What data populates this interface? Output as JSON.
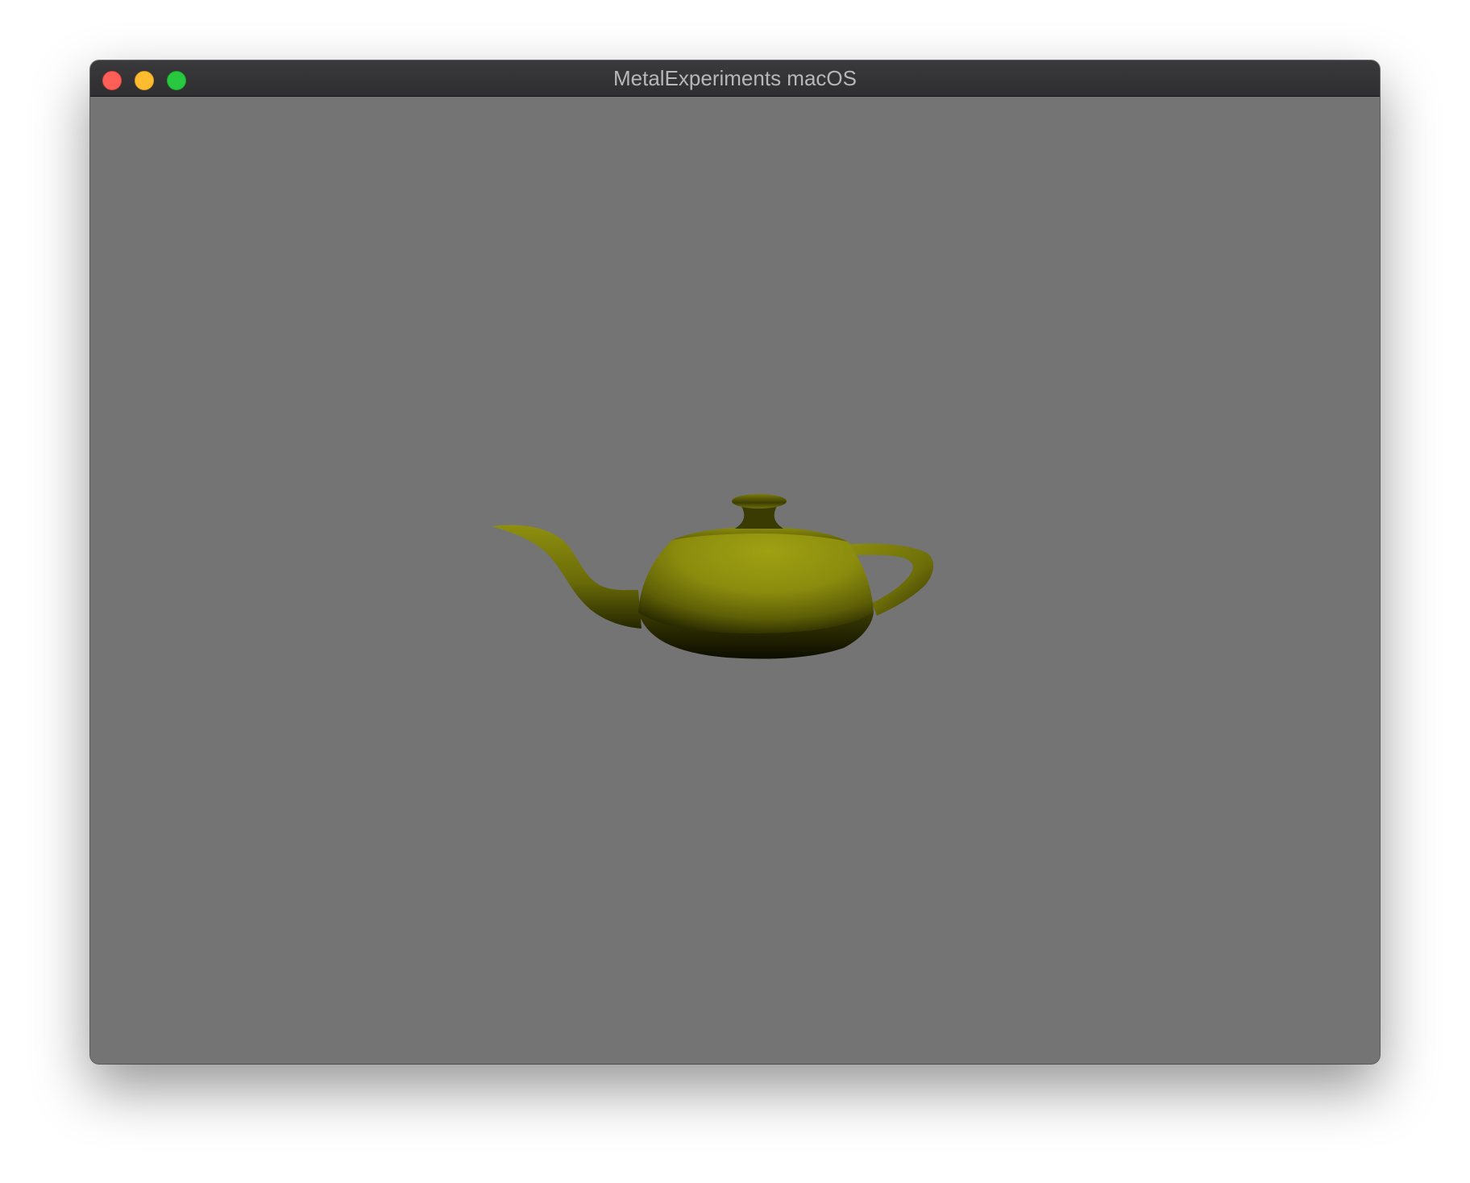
{
  "window": {
    "title": "MetalExperiments macOS"
  },
  "traffic_lights": {
    "close_icon": "close-icon",
    "minimize_icon": "minimize-icon",
    "zoom_icon": "zoom-icon"
  },
  "colors": {
    "viewport_background": "#747474",
    "teapot_base": "#8c8c10",
    "teapot_highlight": "#9d9e12",
    "close": "#fe5f57",
    "minimize": "#febc2e",
    "zoom": "#28c840"
  }
}
